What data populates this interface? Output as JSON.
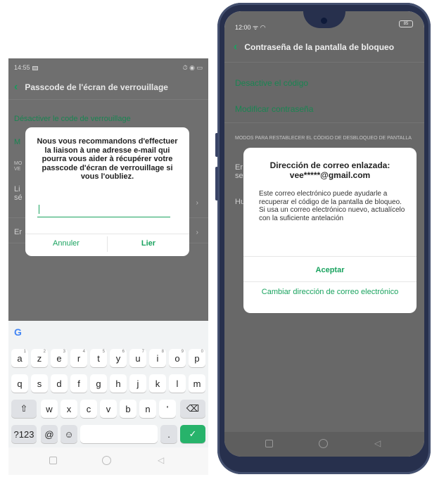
{
  "left": {
    "status": {
      "time": "14:55",
      "right_icons": "⏱ ◉ ▭"
    },
    "header": {
      "title": "Passcode de l'écran de verrouillage"
    },
    "rows": {
      "disable": "Désactiver le code de verrouillage",
      "modify_fragment": "M",
      "section_fragment_1": "MO",
      "section_fragment_2": "VE",
      "link_fragment_1": "Li",
      "link_fragment_2": "sé",
      "email_fragment": "Er"
    },
    "dialog": {
      "message": "Nous vous recommandons d'effectuer la liaison à une adresse e-mail qui pourra vous aider à récupérer votre passcode d'écran de verrouillage si vous l'oubliez.",
      "input_value": "",
      "cancel_label": "Annuler",
      "confirm_label": "Lier"
    },
    "keyboard": {
      "google_logo": "G",
      "row1": [
        {
          "k": "a",
          "n": "1"
        },
        {
          "k": "z",
          "n": "2"
        },
        {
          "k": "e",
          "n": "3"
        },
        {
          "k": "r",
          "n": "4"
        },
        {
          "k": "t",
          "n": "5"
        },
        {
          "k": "y",
          "n": "6"
        },
        {
          "k": "u",
          "n": "7"
        },
        {
          "k": "i",
          "n": "8"
        },
        {
          "k": "o",
          "n": "9"
        },
        {
          "k": "p",
          "n": "0"
        }
      ],
      "row2": [
        "q",
        "s",
        "d",
        "f",
        "g",
        "h",
        "j",
        "k",
        "l",
        "m"
      ],
      "row3": [
        "w",
        "x",
        "c",
        "v",
        "b",
        "n",
        "'"
      ],
      "shift": "⇧",
      "backspace": "⌫",
      "symbols": "?123",
      "at": "@",
      "emoji": "☺",
      "period": ".",
      "enter": "✓"
    },
    "nav": {
      "back": "◁"
    }
  },
  "right": {
    "status": {
      "time": "12:00",
      "battery": "85"
    },
    "header": {
      "title": "Contraseña de la pantalla de bloqueo"
    },
    "rows": {
      "disable": "Desactive el código",
      "modify": "Modificar contraseña",
      "section_header": "MODOS PARA RESTABLECER EL CÓDIGO DE DESBLOQUEO DE PANTALLA",
      "frag_1a": "Er",
      "frag_1b": "se",
      "frag_2": "Hu"
    },
    "dialog": {
      "title_line1": "Dirección de correo enlazada:",
      "title_line2": "vee*****@gmail.com",
      "body": "Este correo electrónico puede ayudarle a recuperar el código de la pantalla de bloqueo. Si usa un correo electrónico nuevo, actualícelo con la suficiente antelación",
      "accept_label": "Aceptar",
      "change_label": "Cambiar dirección de correo electrónico"
    },
    "nav": {
      "back": "◁"
    }
  },
  "colors": {
    "accent": "#1aa35f",
    "overlay": "#686868",
    "phone_frame": "#27304d"
  }
}
